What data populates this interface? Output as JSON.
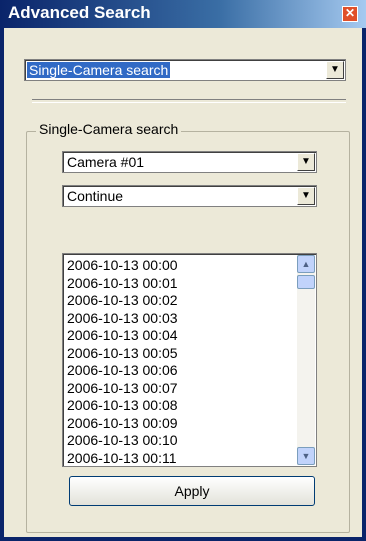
{
  "window": {
    "title": "Advanced Search"
  },
  "mode_select": {
    "value": "Single-Camera search"
  },
  "group": {
    "label": "Single-Camera search",
    "camera_select": {
      "value": "Camera #01"
    },
    "mode2_select": {
      "value": "Continue"
    },
    "timestamps": [
      "2006-10-13 00:00",
      "2006-10-13 00:01",
      "2006-10-13 00:02",
      "2006-10-13 00:03",
      "2006-10-13 00:04",
      "2006-10-13 00:05",
      "2006-10-13 00:06",
      "2006-10-13 00:07",
      "2006-10-13 00:08",
      "2006-10-13 00:09",
      "2006-10-13 00:10",
      "2006-10-13 00:11"
    ],
    "apply_label": "Apply"
  },
  "icons": {
    "close": "close-icon",
    "dropdown": "chevron-down-icon",
    "scroll_up": "scroll-up-icon",
    "scroll_down": "scroll-down-icon"
  },
  "colors": {
    "titlebar": "#0a246a",
    "selection": "#316ac5",
    "close": "#e0502a"
  }
}
